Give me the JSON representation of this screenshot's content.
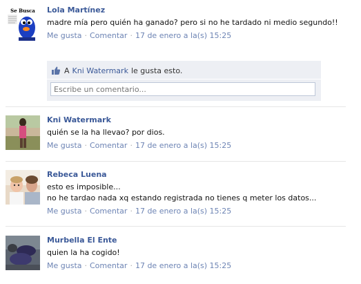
{
  "posts": [
    {
      "author": "Lola Martínez",
      "text": "madre mía pero quién ha ganado? pero si no he tardado ni medio segundo!!",
      "like": "Me gusta",
      "comment": "Comentar",
      "timestamp": "17 de enero a la(s) 15:25",
      "avatar_caption": "Se Busca"
    },
    {
      "author": "Kni Watermark",
      "text": "quién se la ha llevao? por dios.",
      "like": "Me gusta",
      "comment": "Comentar",
      "timestamp": "17 de enero a la(s) 15:25"
    },
    {
      "author": "Rebeca Luena",
      "text": "esto es imposible...\nno he tardao nada xq estando registrada no tienes q meter los datos...",
      "like": "Me gusta",
      "comment": "Comentar",
      "timestamp": "17 de enero a la(s) 15:25"
    },
    {
      "author": "Murbella El Ente",
      "text": "quien la ha cogido!",
      "like": "Me gusta",
      "comment": "Comentar",
      "timestamp": "17 de enero a la(s) 15:25"
    }
  ],
  "likes_box": {
    "prefix": "A",
    "liker": "Kni Watermark",
    "suffix": "le gusta esto.",
    "comment_placeholder": "Escribe un comentario..."
  },
  "separator": "·",
  "colors": {
    "link": "#3b5998",
    "meta": "#8e8e8e",
    "likes_bg": "#edeff4"
  }
}
